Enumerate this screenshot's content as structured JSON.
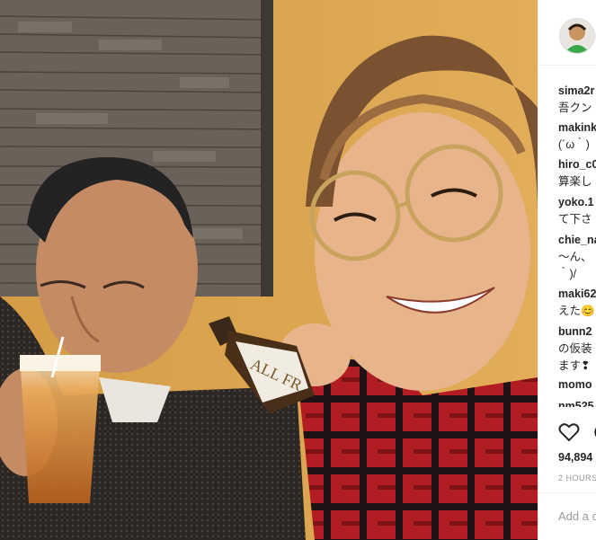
{
  "post": {
    "comments": [
      {
        "user": "sima2r",
        "text": "吾クン"
      },
      {
        "user": "makink",
        "text": "(´ω｀)"
      },
      {
        "user": "hiro_c0",
        "text": "算楽し"
      },
      {
        "user": "yoko.1",
        "text": "て下さ"
      },
      {
        "user": "chie_na",
        "text": "〜ん、"
      },
      {
        "user": "",
        "text": "｀)/"
      },
      {
        "user": "maki62",
        "text": "えた😊"
      },
      {
        "user": "bunn2",
        "text": "の仮装"
      },
      {
        "user": "",
        "text": "ます❢"
      },
      {
        "user": "momo",
        "text": ""
      },
      {
        "user": "nm525",
        "text": ""
      }
    ],
    "likes": "94,894",
    "time": "2 HOURS",
    "add_comment_placeholder": "Add a c"
  },
  "photo": {
    "bottle_label": "ALL FR"
  },
  "icons": {
    "avatar": "avatar-icon",
    "like": "heart-icon",
    "comment": "comment-icon"
  }
}
